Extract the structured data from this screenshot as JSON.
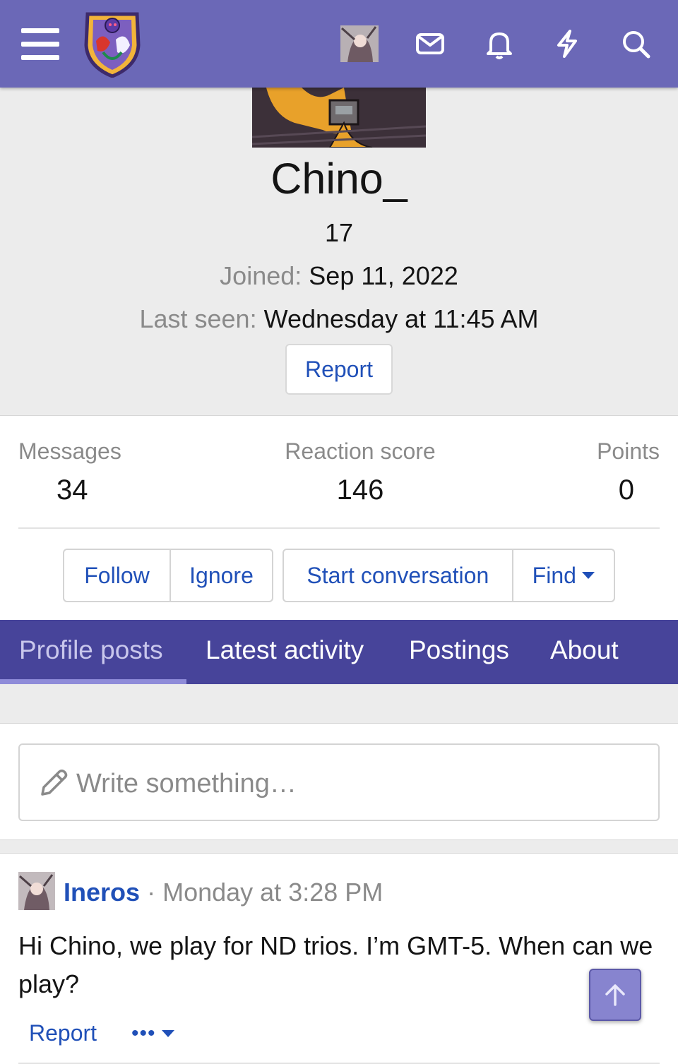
{
  "header": {
    "menu_icon": "hamburger-menu-icon",
    "logo_icon": "forum-logo-shield",
    "avatar_icon": "user-avatar",
    "icons": [
      "envelope-icon",
      "bell-icon",
      "lightning-icon",
      "search-icon"
    ],
    "accent_color": "#6b68b7"
  },
  "profile": {
    "username": "Chino_",
    "user_title": "17",
    "joined_label": "Joined:",
    "joined_value": "Sep 11, 2022",
    "last_seen_label": "Last seen:",
    "last_seen_value": "Wednesday at 11:45 AM",
    "report_label": "Report"
  },
  "stats": {
    "messages_label": "Messages",
    "messages_value": "34",
    "reaction_label": "Reaction score",
    "reaction_value": "146",
    "points_label": "Points",
    "points_value": "0"
  },
  "actions": {
    "follow": "Follow",
    "ignore": "Ignore",
    "start_conversation": "Start conversation",
    "find": "Find"
  },
  "tabs": [
    {
      "label": "Profile posts",
      "active": true
    },
    {
      "label": "Latest activity",
      "active": false
    },
    {
      "label": "Postings",
      "active": false
    },
    {
      "label": "About",
      "active": false
    }
  ],
  "compose": {
    "placeholder": "Write something…",
    "icon": "pencil-icon"
  },
  "post": {
    "author": "Ineros",
    "separator": "·",
    "time": "Monday at 3:28 PM",
    "text": "Hi Chino, we play for ND trios. I’m GMT-5. When can we play?",
    "report_label": "Report",
    "more_label": "•••"
  },
  "scroll_top_icon": "arrow-up-icon"
}
